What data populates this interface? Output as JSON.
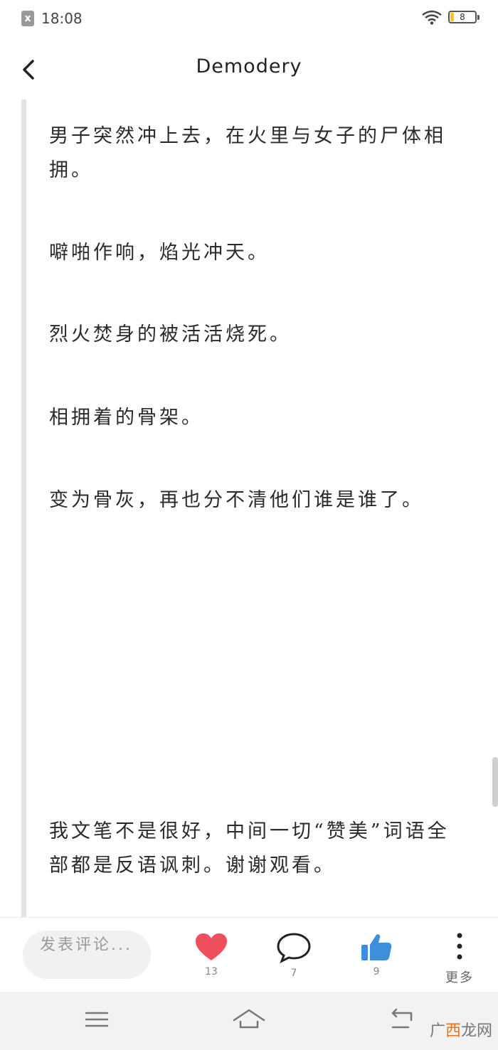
{
  "status_bar": {
    "time": "18:08",
    "battery": "8",
    "notif_icon": "x-notification-icon"
  },
  "header": {
    "title": "Demodery"
  },
  "article": {
    "paragraphs": [
      "男子突然冲上去，在火里与女子的尸体相拥。",
      "噼啪作响，焰光冲天。",
      "烈火焚身的被活活烧死。",
      "相拥着的骨架。",
      "变为骨灰，再也分不清他们谁是谁了。",
      "我文笔不是很好，中间一切“赞美”词语全部都是反语讽刺。谢谢观看。"
    ]
  },
  "actions": {
    "comment_placeholder": "发表评论...",
    "like_count": "13",
    "comment_count": "7",
    "thumb_count": "9",
    "more_label": "更多",
    "colors": {
      "heart": "#f0505e",
      "thumb": "#3d8fdc"
    }
  },
  "watermark": {
    "prefix": "广",
    "accent": "西",
    "suffix": "龙网"
  }
}
